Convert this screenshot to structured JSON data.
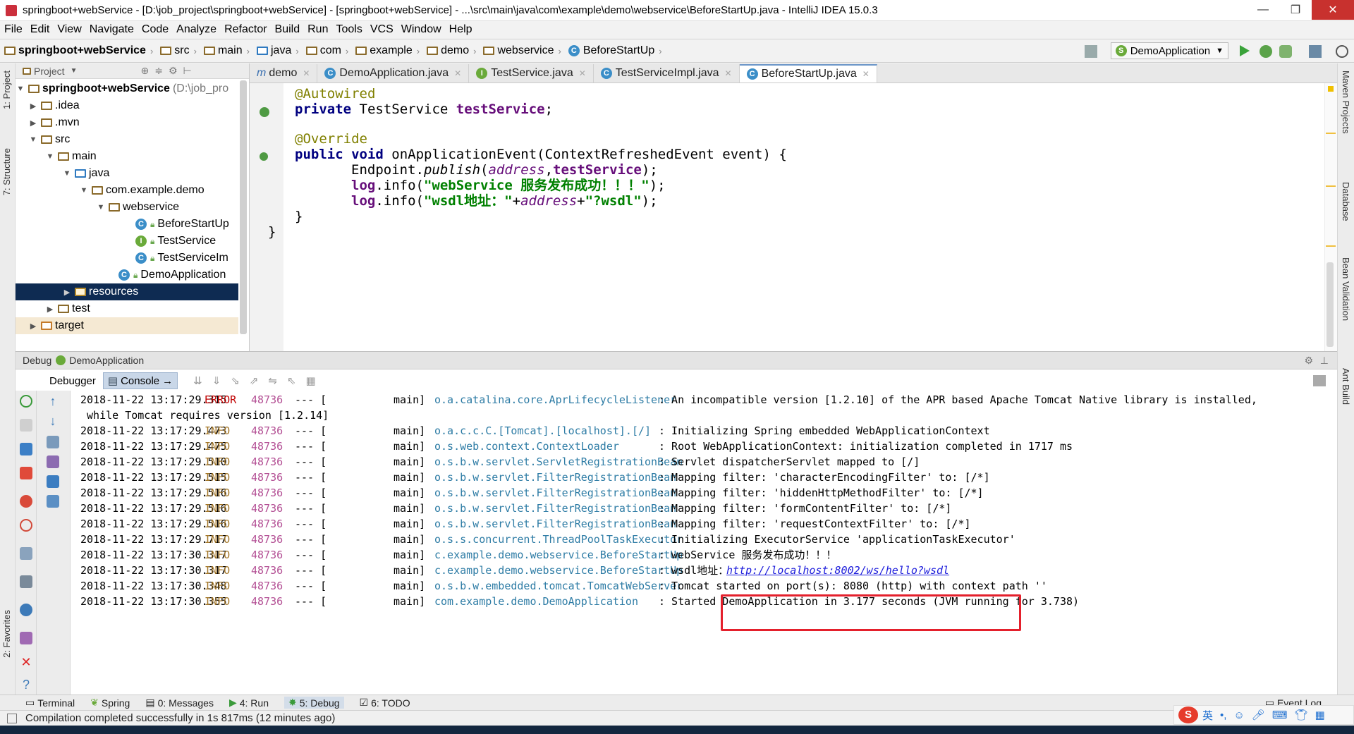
{
  "window": {
    "title": "springboot+webService - [D:\\job_project\\springboot+webService] - [springboot+webService] - ...\\src\\main\\java\\com\\example\\demo\\webservice\\BeforeStartUp.java - IntelliJ IDEA 15.0.3",
    "minimize": "—",
    "maximize": "❐",
    "close": "✕"
  },
  "menu": [
    "File",
    "Edit",
    "View",
    "Navigate",
    "Code",
    "Analyze",
    "Refactor",
    "Build",
    "Run",
    "Tools",
    "VCS",
    "Window",
    "Help"
  ],
  "breadcrumb": [
    "springboot+webService",
    "src",
    "main",
    "java",
    "com",
    "example",
    "demo",
    "webservice",
    "BeforeStartUp"
  ],
  "run_config": "DemoApplication",
  "project_panel": {
    "header": "Project",
    "tree": [
      {
        "label": "springboot+webService",
        "extra": "(D:\\job_pro"
      },
      {
        "label": ".idea"
      },
      {
        "label": ".mvn"
      },
      {
        "label": "src"
      },
      {
        "label": "main"
      },
      {
        "label": "java"
      },
      {
        "label": "com.example.demo"
      },
      {
        "label": "webservice"
      },
      {
        "label": "BeforeStartUp"
      },
      {
        "label": "TestService"
      },
      {
        "label": "TestServiceIm"
      },
      {
        "label": "DemoApplication"
      },
      {
        "label": "resources"
      },
      {
        "label": "test"
      },
      {
        "label": "target"
      }
    ]
  },
  "editor_tabs": [
    {
      "label": "demo",
      "prefix": "m"
    },
    {
      "label": "DemoApplication.java"
    },
    {
      "label": "TestService.java"
    },
    {
      "label": "TestServiceImpl.java"
    },
    {
      "label": "BeforeStartUp.java"
    }
  ],
  "code": {
    "l1": "@Autowired",
    "l2_kw": "private",
    "l2_type": " TestService ",
    "l2_field": "testService",
    "l2_end": ";",
    "l3": "@Override",
    "l4_kw": "public void",
    "l4_rest": " onApplicationEvent(ContextRefreshedEvent event) {",
    "l5_a": "Endpoint.",
    "l5_b": "publish",
    "l5_c": "(",
    "l5_d": "address",
    "l5_e": ",",
    "l5_f": "testService",
    "l5_g": ");",
    "l6_a": "log",
    "l6_b": ".info(",
    "l6_c": "\"webService 服务发布成功！！！\"",
    "l6_d": ");",
    "l7_a": "log",
    "l7_b": ".info(",
    "l7_c": "\"wsdl地址：\"",
    "l7_d": "+",
    "l7_e": "address",
    "l7_f": "+",
    "l7_g": "\"?wsdl\"",
    "l7_h": ");",
    "l8": "}",
    "l9": "}"
  },
  "debug": {
    "header": "Debug",
    "app": "DemoApplication",
    "tab_debugger": "Debugger",
    "tab_console": "Console",
    "logs": [
      {
        "ts": "2018-11-22 13:17:29.315",
        "lvl": "ERROR",
        "pid": "48736",
        "sep": "--- [",
        "th": "main]",
        "logger": "o.a.catalina.core.AprLifecycleListener",
        "msg": ": An incompatible version [1.2.10] of the APR based Apache Tomcat Native library is installed,"
      },
      {
        "cont": " while Tomcat requires version [1.2.14]"
      },
      {
        "ts": "2018-11-22 13:17:29.473",
        "lvl": "INFO",
        "pid": "48736",
        "sep": "--- [",
        "th": "main]",
        "logger": "o.a.c.c.C.[Tomcat].[localhost].[/]",
        "msg": ": Initializing Spring embedded WebApplicationContext"
      },
      {
        "ts": "2018-11-22 13:17:29.475",
        "lvl": "INFO",
        "pid": "48736",
        "sep": "--- [",
        "th": "main]",
        "logger": "o.s.web.context.ContextLoader",
        "msg": ": Root WebApplicationContext: initialization completed in 1717 ms"
      },
      {
        "ts": "2018-11-22 13:17:29.510",
        "lvl": "INFO",
        "pid": "48736",
        "sep": "--- [",
        "th": "main]",
        "logger": "o.s.b.w.servlet.ServletRegistrationBean",
        "msg": ": Servlet dispatcherServlet mapped to [/]"
      },
      {
        "ts": "2018-11-22 13:17:29.515",
        "lvl": "INFO",
        "pid": "48736",
        "sep": "--- [",
        "th": "main]",
        "logger": "o.s.b.w.servlet.FilterRegistrationBean",
        "msg": ": Mapping filter: 'characterEncodingFilter' to: [/*]"
      },
      {
        "ts": "2018-11-22 13:17:29.516",
        "lvl": "INFO",
        "pid": "48736",
        "sep": "--- [",
        "th": "main]",
        "logger": "o.s.b.w.servlet.FilterRegistrationBean",
        "msg": ": Mapping filter: 'hiddenHttpMethodFilter' to: [/*]"
      },
      {
        "ts": "2018-11-22 13:17:29.516",
        "lvl": "INFO",
        "pid": "48736",
        "sep": "--- [",
        "th": "main]",
        "logger": "o.s.b.w.servlet.FilterRegistrationBean",
        "msg": ": Mapping filter: 'formContentFilter' to: [/*]"
      },
      {
        "ts": "2018-11-22 13:17:29.516",
        "lvl": "INFO",
        "pid": "48736",
        "sep": "--- [",
        "th": "main]",
        "logger": "o.s.b.w.servlet.FilterRegistrationBean",
        "msg": ": Mapping filter: 'requestContextFilter' to: [/*]"
      },
      {
        "ts": "2018-11-22 13:17:29.717",
        "lvl": "INFO",
        "pid": "48736",
        "sep": "--- [",
        "th": "main]",
        "logger": "o.s.s.concurrent.ThreadPoolTaskExecutor",
        "msg": ": Initializing ExecutorService 'applicationTaskExecutor'"
      },
      {
        "ts": "2018-11-22 13:17:30.317",
        "lvl": "INFO",
        "pid": "48736",
        "sep": "--- [",
        "th": "main]",
        "logger": "c.example.demo.webservice.BeforeStartUp",
        "msg": ": webService 服务发布成功！！！"
      },
      {
        "ts": "2018-11-22 13:17:30.317",
        "lvl": "INFO",
        "pid": "48736",
        "sep": "--- [",
        "th": "main]",
        "logger": "c.example.demo.webservice.BeforeStartUp",
        "msg": ": wsdl地址：",
        "link": "http://localhost:8002/ws/hello?wsdl"
      },
      {
        "ts": "2018-11-22 13:17:30.348",
        "lvl": "INFO",
        "pid": "48736",
        "sep": "--- [",
        "th": "main]",
        "logger": "o.s.b.w.embedded.tomcat.TomcatWebServer",
        "msg": ": Tomcat started on port(s): 8080 (http) with context path ''"
      },
      {
        "ts": "2018-11-22 13:17:30.355",
        "lvl": "INFO",
        "pid": "48736",
        "sep": "--- [",
        "th": "main]",
        "logger": "com.example.demo.DemoApplication",
        "msg": ": Started DemoApplication in 3.177 seconds (JVM running for 3.738)"
      }
    ]
  },
  "bottom_tabs": [
    {
      "label": "Terminal"
    },
    {
      "label": "Spring"
    },
    {
      "label": "0: Messages"
    },
    {
      "label": "4: Run"
    },
    {
      "label": "5: Debug"
    },
    {
      "label": "6: TODO"
    }
  ],
  "event_log": "Event Log",
  "status": "Compilation completed successfully in 1s 817ms (12 minutes ago)",
  "left_tabs": [
    "1: Project",
    "7: Structure",
    "2: Favorites"
  ],
  "right_tabs": [
    "Maven Projects",
    "Database",
    "Bean Validation",
    "Ant Build"
  ],
  "ime": {
    "lang": "英"
  },
  "colors": {
    "accent": "#0e2b52",
    "error": "#c00000",
    "info": "#a37628",
    "highlight_box": "#e4202c"
  }
}
